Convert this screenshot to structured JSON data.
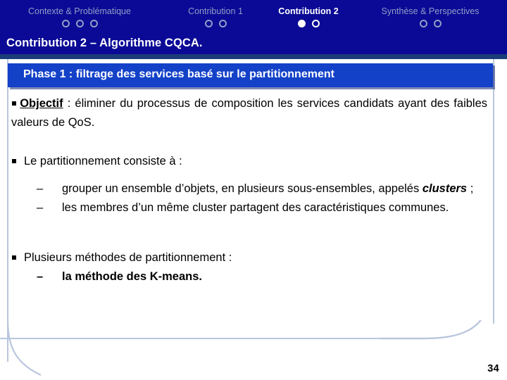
{
  "nav": {
    "items": [
      {
        "label": "Contexte & Problématique",
        "dots": [
          "hollow",
          "hollow",
          "hollow"
        ],
        "active": false
      },
      {
        "label": "Contribution 1",
        "dots": [
          "hollow",
          "hollow"
        ],
        "active": false
      },
      {
        "label": "Contribution 2",
        "dots": [
          "filled",
          "hollow"
        ],
        "active": true
      },
      {
        "label": "Synthèse & Perspectives",
        "dots": [
          "hollow",
          "hollow"
        ],
        "active": false
      }
    ],
    "inactive_color": "#8e9ec6",
    "active_color": "#ffffff"
  },
  "header": {
    "title": "Contribution 2 – Algorithme CQCA.",
    "background_color": "#0a0a96",
    "strip_color": "#1b3d7a"
  },
  "phase": {
    "label": "Phase 1 : filtrage des services basé sur le partitionnement",
    "background_color": "#1341c8",
    "text_color": "#ffffff"
  },
  "content": {
    "objectif": {
      "bullet": "§",
      "keyword": "Objectif",
      "line1": " : éliminer du processus de composition les services",
      "line2": "candidats ayant des faibles valeurs de QoS."
    },
    "partitionnement": {
      "heading": "Le partitionnement consiste à :",
      "subitems": [
        {
          "dash": "–",
          "text_before": "grouper un ensemble d’objets, en plusieurs sous-ensembles, appelés ",
          "emphasis": "clusters",
          "text_after": " ;"
        },
        {
          "dash": "–",
          "text_before": "les membres d’un même cluster partagent des caractéristiques communes.",
          "emphasis": "",
          "text_after": ""
        }
      ]
    },
    "methodes": {
      "heading": "Plusieurs méthodes de partitionnement :",
      "subitems": [
        {
          "dash": "–",
          "text": "la méthode des K-means."
        }
      ]
    }
  },
  "footer": {
    "page_number": "34",
    "decoration_color": "#b9c6dd"
  }
}
